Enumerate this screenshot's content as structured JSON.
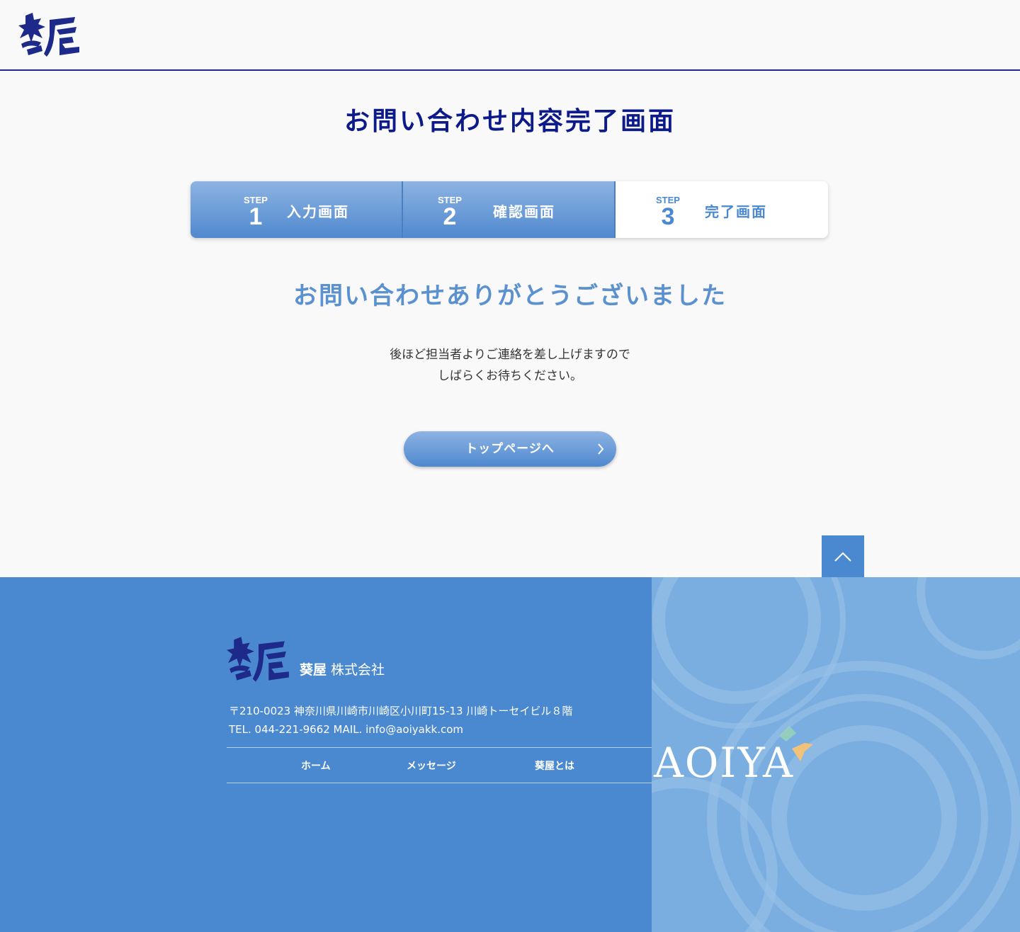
{
  "header": {
    "logo_text": "葵屋"
  },
  "page_title": "お問い合わせ内容完了画面",
  "steps": [
    {
      "step_label": "STEP",
      "number": "1",
      "label": "入力画面"
    },
    {
      "step_label": "STEP",
      "number": "2",
      "label": "確認画面"
    },
    {
      "step_label": "STEP",
      "number": "3",
      "label": "完了画面"
    }
  ],
  "thanks": "お問い合わせありがとうございました",
  "message": {
    "line1": "後ほど担当者よりご連絡を差し上げますので",
    "line2": "しばらくお待ちください。"
  },
  "top_button": {
    "label": "トップページへ",
    "icon": "chevron-right-icon"
  },
  "back_to_top": {
    "icon": "chevron-up-icon"
  },
  "footer": {
    "company_name": "葵屋",
    "company_suffix": "株式会社",
    "address": "〒210-0023 神奈川県川崎市川崎区小川町15-13 川崎トーセイビル８階",
    "contact": "TEL. 044-221-9662 MAIL. info@aoiyakk.com",
    "nav": [
      "ホーム",
      "メッセージ",
      "葵屋とは"
    ],
    "brand_text": "AOIYA"
  },
  "colors": {
    "navy": "#0c1a8a",
    "accent_blue": "#4a89cf",
    "light_blue": "#5b91cf"
  }
}
